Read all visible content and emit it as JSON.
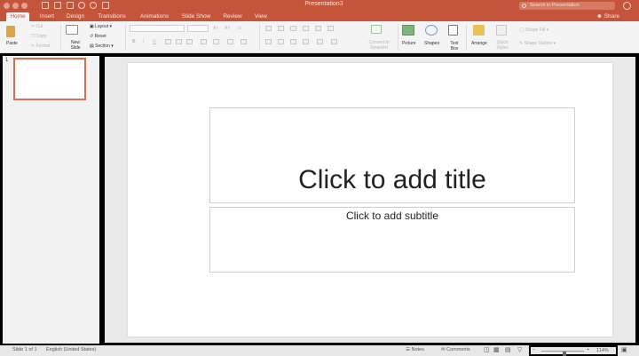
{
  "window": {
    "title": "Presentation3"
  },
  "search": {
    "placeholder": "Search in Presentation"
  },
  "tabs": [
    {
      "label": "Home",
      "active": true
    },
    {
      "label": "Insert"
    },
    {
      "label": "Design"
    },
    {
      "label": "Transitions"
    },
    {
      "label": "Animations"
    },
    {
      "label": "Slide Show"
    },
    {
      "label": "Review"
    },
    {
      "label": "View"
    }
  ],
  "share": {
    "label": "Share"
  },
  "ribbon": {
    "paste": "Paste",
    "cut": "Cut",
    "copy": "Copy",
    "format": "Format",
    "new_slide": "New Slide",
    "layout": "Layout",
    "reset": "Reset",
    "section": "Section",
    "convert_smartart": "Convert to SmartArt",
    "picture": "Picture",
    "shapes": "Shapes",
    "text_box": "Text Box",
    "arrange": "Arrange",
    "quick_styles": "Quick Styles",
    "shape_fill": "Shape Fill",
    "shape_outline": "Shape Outline"
  },
  "thumbnails": [
    {
      "number": "1"
    }
  ],
  "slide": {
    "title_placeholder": "Click to add title",
    "subtitle_placeholder": "Click to add subtitle"
  },
  "status": {
    "slide_count": "Slide 1 of 1",
    "language": "English (United States)",
    "notes": "Notes",
    "comments": "Comments",
    "zoom": "114%",
    "zoom_level": 0.55
  },
  "colors": {
    "accent": "#c4553a",
    "thumb_selected": "#d5704f"
  }
}
